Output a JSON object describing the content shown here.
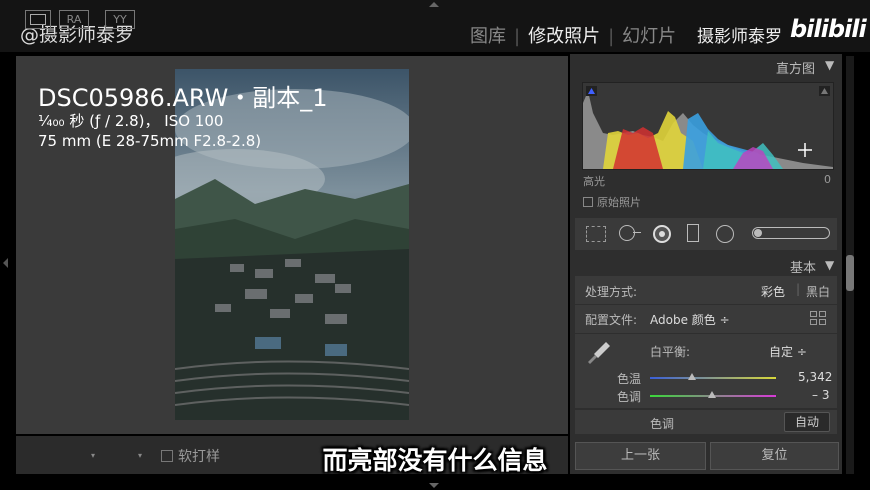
{
  "watermark": "@摄影师泰罗",
  "modules": {
    "library": "图库",
    "develop": "修改照片",
    "slideshow": "幻灯片"
  },
  "overlay_name": "摄影师泰罗",
  "bilibili": "bilibili",
  "photo_info": {
    "filename": "DSC05986.ARW・副本_1",
    "exposure": "¹⁄₄₀₀ 秒 (ƒ / 2.8)， ISO 100",
    "lens": "75 mm (E 28-75mm F2.8-2.8)"
  },
  "toolbar": {
    "ra": "RA",
    "yy": "YY",
    "soft_proof": "软打样"
  },
  "subtitle": "而亮部没有什么信息",
  "histogram": {
    "title": "直方图",
    "highlight_label": "高光",
    "highlight_value": "0",
    "original_photo": "原始照片"
  },
  "basic": {
    "title": "基本",
    "treatment_label": "处理方式:",
    "treatment_color": "彩色",
    "treatment_bw": "黑白",
    "profile_label": "配置文件:",
    "profile_value": "Adobe 颜色 ÷",
    "wb_label": "白平衡:",
    "wb_value": "自定 ÷",
    "temp_label": "色温",
    "temp_value": "5,342",
    "tint_label": "色调",
    "tint_value": "– 3",
    "tone_label": "色调",
    "auto_label": "自动"
  },
  "nav": {
    "previous": "上一张",
    "reset": "复位"
  },
  "slider_levels": {
    "temp": 0.33,
    "tint": 0.49
  },
  "colors": {
    "panel_bg": "#2e2e2e",
    "viewer_bg": "#3a3a3a"
  }
}
